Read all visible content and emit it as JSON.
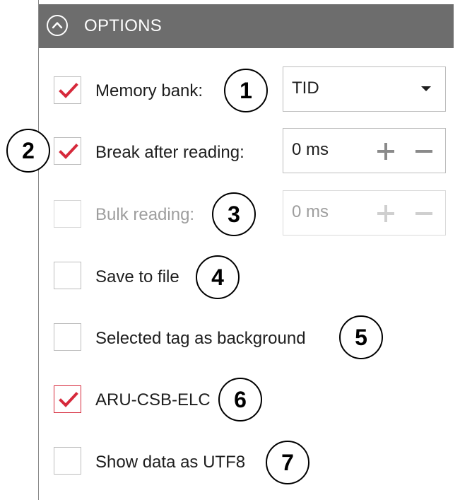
{
  "header": {
    "title": "OPTIONS",
    "collapse_icon": "chevron-up-circle-icon"
  },
  "options": {
    "memory_bank": {
      "label": "Memory bank:",
      "checked": true,
      "value": "TID",
      "callout": "1"
    },
    "break_after_reading": {
      "label": "Break after reading:",
      "checked": true,
      "value": "0 ms",
      "callout": "2"
    },
    "bulk_reading": {
      "label": "Bulk reading:",
      "checked": false,
      "disabled": true,
      "value": "0 ms",
      "callout": "3"
    },
    "save_to_file": {
      "label": "Save to file",
      "checked": false,
      "callout": "4"
    },
    "selected_tag_background": {
      "label": "Selected tag as background",
      "checked": false,
      "callout": "5"
    },
    "aru_csb_elc": {
      "label": "ARU-CSB-ELC",
      "checked": true,
      "callout": "6"
    },
    "show_data_utf8": {
      "label": "Show data as UTF8",
      "checked": false,
      "callout": "7"
    }
  },
  "colors": {
    "header_bg": "#6d6d6d",
    "check_red": "#d6293b",
    "checkbox_border": "#bdbdbd",
    "disabled_text": "#9e9e9e"
  }
}
